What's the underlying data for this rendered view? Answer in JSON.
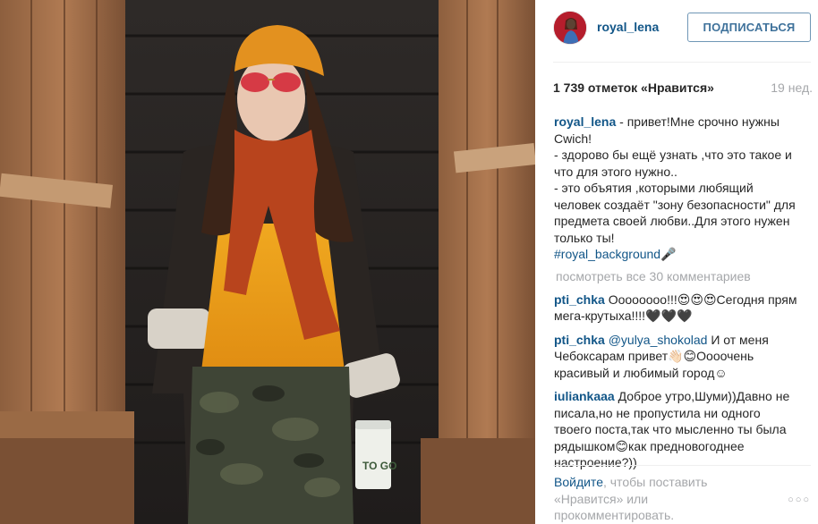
{
  "header": {
    "username": "royal_lena",
    "follow_label": "ПОДПИСАТЬСЯ"
  },
  "stats": {
    "likes": "1 739 отметок «Нравится»",
    "time_ago": "19 нед."
  },
  "caption": {
    "user": "royal_lena",
    "text": " - привет!Мне срочно нужны Cwich!\n- здорово бы ещё узнать ,что это такое и что для этого нужно..\n- это объятия ,которыми любящий человек создаёт \"зону безопасности\" для предмета своей любви..Для этого нужен только ты!",
    "hashtag": "#royal_background",
    "hashtag_suffix": "🎤"
  },
  "view_all_comments": "посмотреть все 30 комментариев",
  "comments": [
    {
      "user": "pti_chka",
      "text": " Оооооооо!!!😍😍😍Сегодня прям мега-крутыха!!!!🖤🖤🖤"
    },
    {
      "user": "pti_chka",
      "mention": "@yulya_shokolad",
      "text": " И от меня Чебоксарам привет👋🏻😊Оооочень красивый и любимый город☺"
    },
    {
      "user": "iuliankaaa",
      "text": " Доброе утро,Шуми))Давно не писала,но не пропустила ни одного твоего поста,так что мысленно ты была рядышком😊как предновогоднее настроение?))"
    }
  ],
  "footer": {
    "login_link": "Войдите",
    "rest": ", чтобы поставить «Нравится» или прокомментировать."
  },
  "more_icon": "more-dots-icon",
  "colors": {
    "link_blue": "#125688",
    "button_blue": "#3f729b",
    "muted_gray": "#a5a7aa"
  }
}
